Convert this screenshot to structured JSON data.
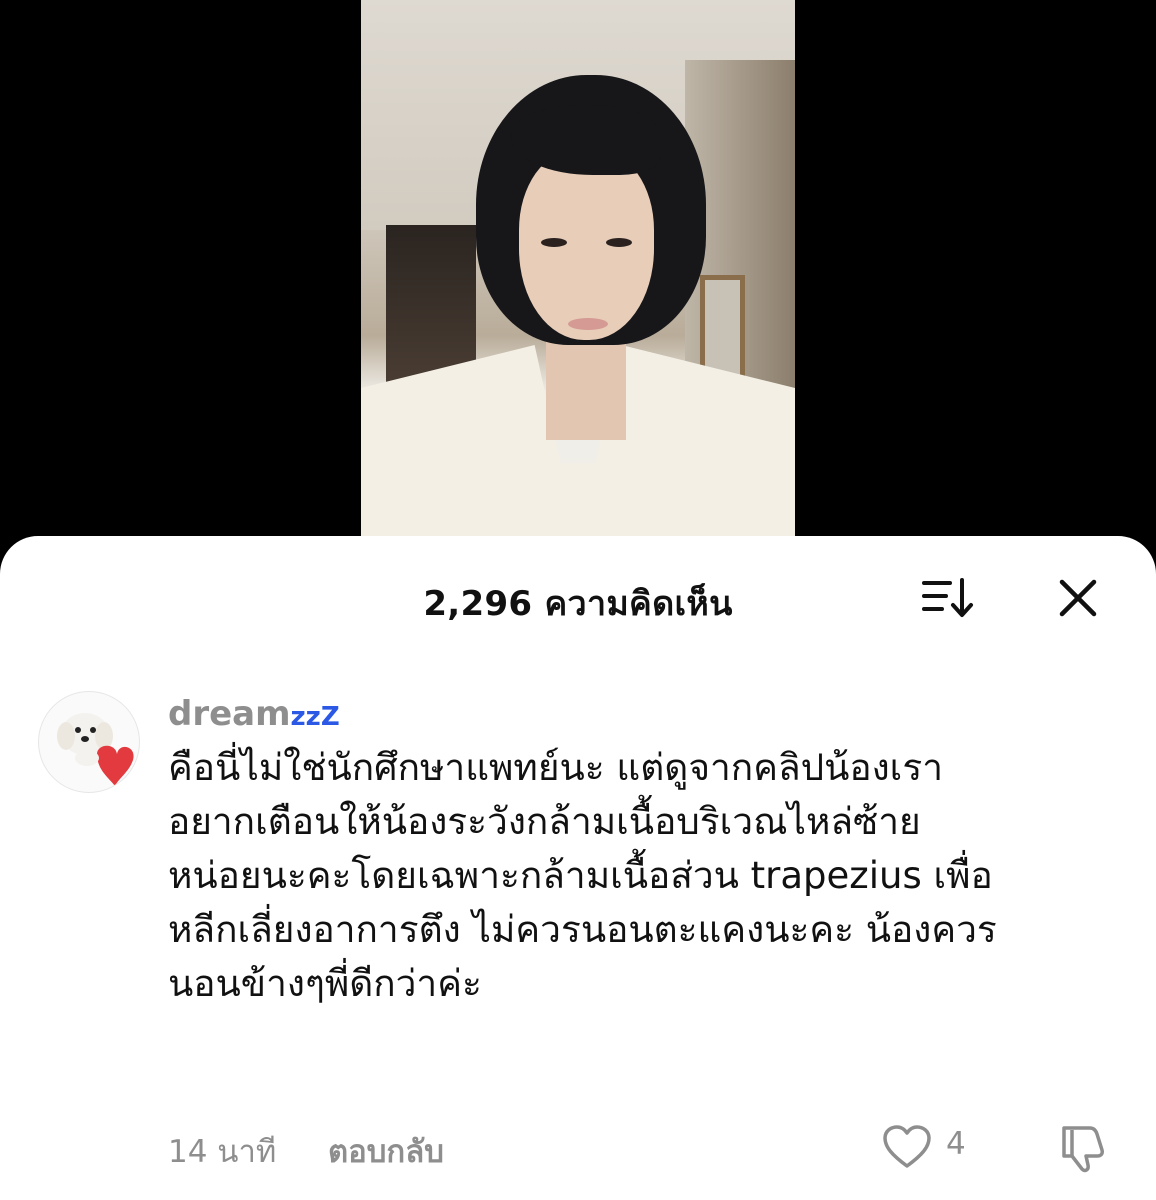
{
  "video": {
    "description_icon": "live-video-frame"
  },
  "comments_sheet": {
    "title": "2,296 ความคิดเห็น",
    "sort_icon": "sort-icon",
    "close_icon": "close-icon"
  },
  "comment": {
    "avatar_icon": "avatar-dog-with-heart",
    "username": "dream",
    "username_suffix": "zzZ",
    "lines": [
      "คือนี่ไม่ใช่นักศึกษาแพทย์นะ แต่ดูจากคลิปน้องเรา",
      "อยากเตือนให้น้องระวังกล้ามเนื้อบริเวณไหล่ซ้าย",
      "หน่อยนะคะโดยเฉพาะกล้ามเนื้อส่วน trapezius เพื่อ",
      "หลีกเลี่ยงอาการตึง ไม่ควรนอนตะแคงนะคะ น้องควร",
      "นอนข้างๆพี่ดีกว่าค่ะ"
    ],
    "time": "14 นาที",
    "reply_label": "ตอบกลับ",
    "like_count": "4",
    "like_icon": "heart-icon",
    "dislike_icon": "thumbs-down-icon"
  },
  "colors": {
    "accent_zzz": "#2b59e6",
    "secondary_text": "#8e8e8e",
    "primary_text": "#111111"
  }
}
